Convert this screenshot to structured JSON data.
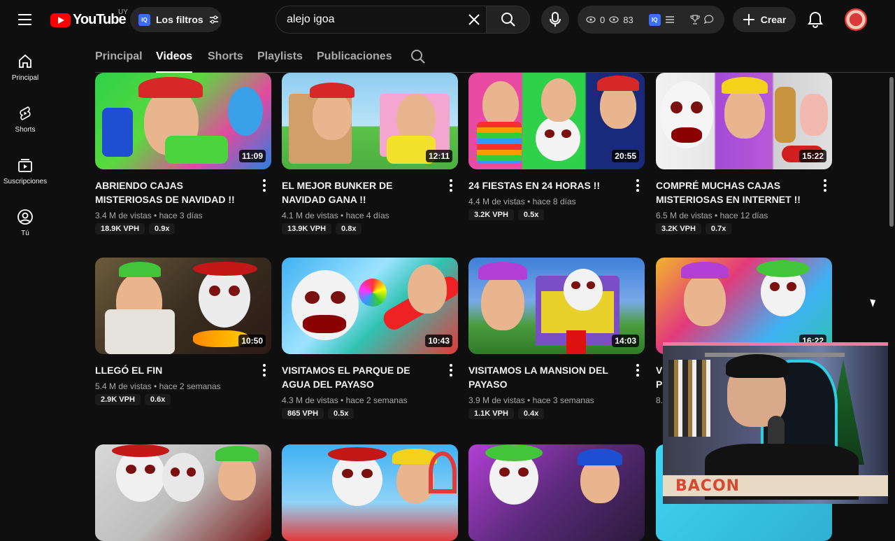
{
  "header": {
    "logo_text": "YouTube",
    "country_code": "UY",
    "filters_badge": "IQ",
    "filters_label": "Los filtros",
    "search_value": "alejo igoa",
    "ext_views_a": "0",
    "ext_views_b": "83",
    "ext_badge": "IQ",
    "create_label": "Crear"
  },
  "sidebar": {
    "items": [
      {
        "label": "Principal",
        "icon": "home-icon"
      },
      {
        "label": "Shorts",
        "icon": "shorts-icon"
      },
      {
        "label": "Suscripciones",
        "icon": "subscriptions-icon"
      },
      {
        "label": "Tú",
        "icon": "user-icon"
      }
    ]
  },
  "tabs": {
    "items": [
      "Principal",
      "Videos",
      "Shorts",
      "Playlists",
      "Publicaciones"
    ],
    "active": "Videos"
  },
  "videos": [
    {
      "title": "Abriendo cajas misteriosas de navidad !!",
      "duration": "11:09",
      "views": "3.4 M de vistas",
      "age": "hace 3 días",
      "vph": "18.9K VPH",
      "ratio": "0.9x"
    },
    {
      "title": "El mejor bunker de navidad gana !!",
      "duration": "12:11",
      "views": "4.1 M de vistas",
      "age": "hace 4 días",
      "vph": "13.9K VPH",
      "ratio": "0.8x"
    },
    {
      "title": "24 fiestas en 24 horas !!",
      "duration": "20:55",
      "views": "4.4 M de vistas",
      "age": "hace 8 días",
      "vph": "3.2K VPH",
      "ratio": "0.5x"
    },
    {
      "title": "Compré muchas cajas misteriosas en internet !!",
      "duration": "15:22",
      "views": "6.5 M de vistas",
      "age": "hace 12 días",
      "vph": "3.2K VPH",
      "ratio": "0.7x"
    },
    {
      "title": "Llegó el fin",
      "duration": "10:50",
      "views": "5.4 M de vistas",
      "age": "hace 2 semanas",
      "vph": "2.9K VPH",
      "ratio": "0.6x"
    },
    {
      "title": "Visitamos el parque de agua del payaso",
      "duration": "10:43",
      "views": "4.3 M de vistas",
      "age": "hace 2 semanas",
      "vph": "865 VPH",
      "ratio": "0.5x"
    },
    {
      "title": "Visitamos la mansion del payaso",
      "duration": "14:03",
      "views": "3.9 M de vistas",
      "age": "hace 3 semanas",
      "vph": "1.1K VPH",
      "ratio": "0.4x"
    },
    {
      "title": "V",
      "title_line2": "P",
      "duration": "16:22",
      "views": "8.",
      "age": "",
      "vph": "",
      "ratio": ""
    }
  ],
  "webcam": {
    "banner_text": "BACON"
  },
  "colors": {
    "brand_red": "#ff0000",
    "background": "#0f0f0f",
    "chip": "#272727",
    "accent_blue": "#3b6df5",
    "webcam_border": "#f27aa0",
    "banner_text": "#d5492f"
  }
}
